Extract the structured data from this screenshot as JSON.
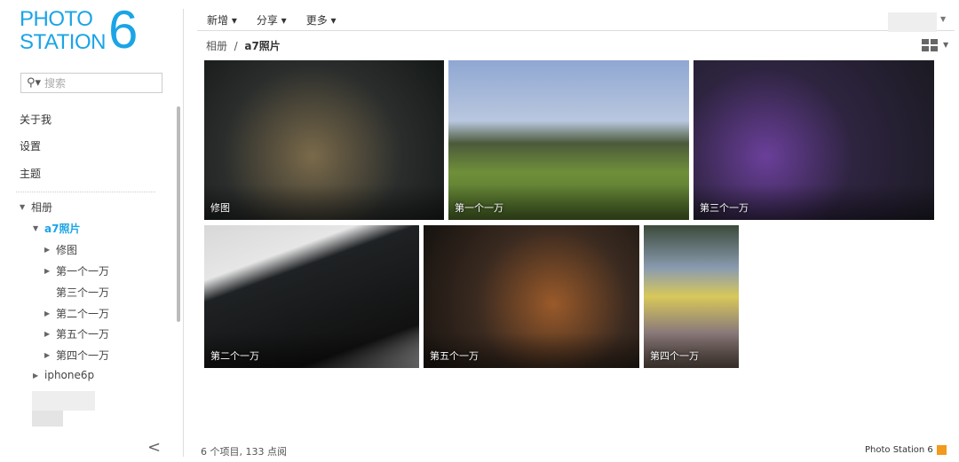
{
  "logo": {
    "line1": "PHOTO",
    "line2": "STATION",
    "number": "6"
  },
  "search": {
    "placeholder": "搜索",
    "icon": "search-icon"
  },
  "nav": [
    "关于我",
    "设置",
    "主题"
  ],
  "tree": {
    "root": "相册",
    "album": "a7照片",
    "children": [
      {
        "label": "修图",
        "expandable": true
      },
      {
        "label": "第一个一万",
        "expandable": true
      },
      {
        "label": "第三个一万",
        "expandable": false
      },
      {
        "label": "第二个一万",
        "expandable": true
      },
      {
        "label": "第五个一万",
        "expandable": true
      },
      {
        "label": "第四个一万",
        "expandable": true
      }
    ],
    "other": "iphone6p"
  },
  "toolbar": {
    "new": "新增 ▾",
    "share": "分享 ▾",
    "more": "更多 ▾"
  },
  "breadcrumb": {
    "root": "相册",
    "sep": "/",
    "current": "a7照片"
  },
  "photos": [
    {
      "caption": "修图"
    },
    {
      "caption": "第一个一万"
    },
    {
      "caption": "第三个一万"
    },
    {
      "caption": "第二个一万"
    },
    {
      "caption": "第五个一万"
    },
    {
      "caption": "第四个一万"
    }
  ],
  "footer": {
    "status": "6 个项目, 133 点阅",
    "brand": "Photo Station 6"
  },
  "accent": "#1ba4e6"
}
